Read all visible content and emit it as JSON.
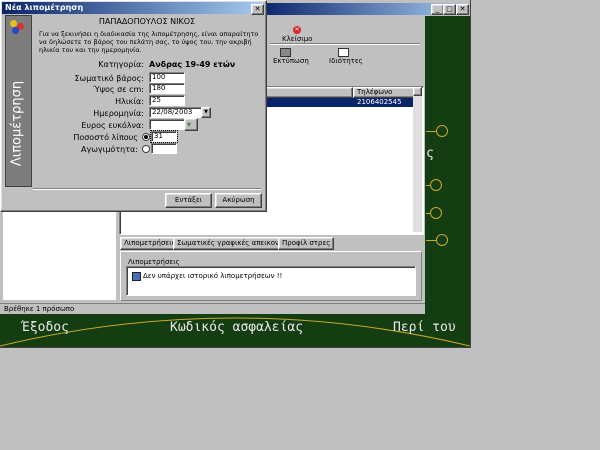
{
  "dialog": {
    "title": "Νέα λιπομέτρηση",
    "person_name": "ΠΑΠΑΔΟΠΟΥΛΟΣ ΝΙΚΟΣ",
    "intro": "Για να ξεκινήσει η διαδικασία της λιπομέτρησης, είναι απαραίτητο να δηλώσετε το βάρος του πελάτη σας, το ύψος του, την ακριβή ηλικία του και την ημερομηνία.",
    "side_label": "Λιπομέτρηση",
    "category_label": "Κατηγορία:",
    "category_value": "Ανδρας 19-49 ετών",
    "fields": {
      "weight": {
        "label": "Σωματικό βάρος:",
        "value": "100"
      },
      "height": {
        "label": "Ύψος σε cm:",
        "value": "180"
      },
      "age": {
        "label": "Ηλικία:",
        "value": "25"
      },
      "date": {
        "label": "Ημερομηνία:",
        "value": "22/08/2003"
      },
      "ideal_weight": {
        "label": "Ευρος ευκόλνα:",
        "value": ""
      },
      "fat_percent": {
        "label": "Ποσοστό λίπους",
        "value": "31"
      },
      "fitness": {
        "label": "Αγωγιμότητα:",
        "value": ""
      }
    },
    "ok_label": "Εντάξει",
    "cancel_label": "Ακύρωση"
  },
  "main": {
    "toolbar": {
      "close_label": "Κλείσιμο",
      "print_label": "Εκτύπωση",
      "properties_label": "Ιδιότητες"
    },
    "table": {
      "col_phone": "Τηλέφωνο",
      "selected_phone": "2106402545"
    },
    "tabs": [
      "Λιπομετρήσεις",
      "Σωματικές γραφικές απεικονίσεις",
      "Προφίλ στρες"
    ],
    "history_header": "Λιπομετρήσεις",
    "history_message": "Δεν υπάρχει ιστορικό λιπομετρήσεων !!",
    "status": "Βρέθηκε 1 πρόσωπο"
  },
  "menu": {
    "exit": "Έξοδος",
    "insurance_code": "Κωδικός ασφαλείας",
    "about": "Περί του",
    "partial_char": "ς"
  },
  "colors": {
    "green": "#143e12",
    "gold": "#c9a829",
    "selection": "#0a246a"
  }
}
